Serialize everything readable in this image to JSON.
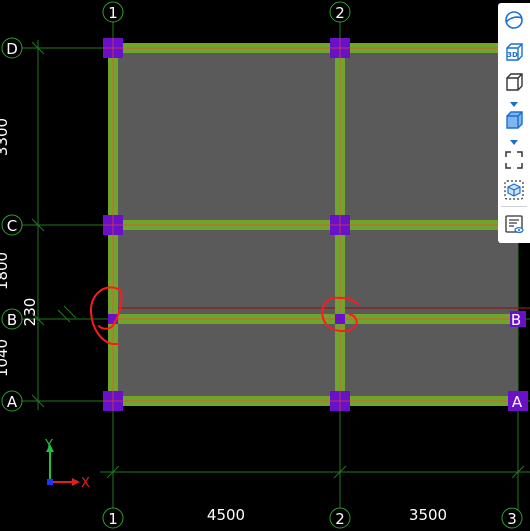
{
  "grid_axes": {
    "col_1": "1",
    "col_2": "2",
    "col_3": "3",
    "row_D": "D",
    "row_C": "C",
    "row_B": "B",
    "row_A": "A",
    "row_B_right": "B",
    "row_A_right": "A"
  },
  "dimensions": {
    "bottom_1": "4500",
    "bottom_2": "3500",
    "left_DC": "3300",
    "left_CB": "1800",
    "left_BA": "1040",
    "left_offset": "230"
  },
  "axis_gizmo": {
    "y_label": "Y",
    "x_label": "X"
  },
  "toolbar": {
    "items": [
      {
        "name": "orbit-view-icon"
      },
      {
        "name": "view-3d-icon",
        "text": "3D"
      },
      {
        "name": "box-view-icon"
      },
      {
        "name": "solid-view-icon"
      },
      {
        "name": "frame-select-icon"
      },
      {
        "name": "section-box-icon"
      },
      {
        "name": "properties-view-icon"
      }
    ]
  },
  "colors": {
    "background": "#000000",
    "beam_green": "#6fa52e",
    "beam_center": "#b9752f",
    "slab": "#5a5a5a",
    "column": "#6a10c8",
    "grid_line": "#1f7a1f",
    "annotation_red": "#ff1a1a"
  }
}
